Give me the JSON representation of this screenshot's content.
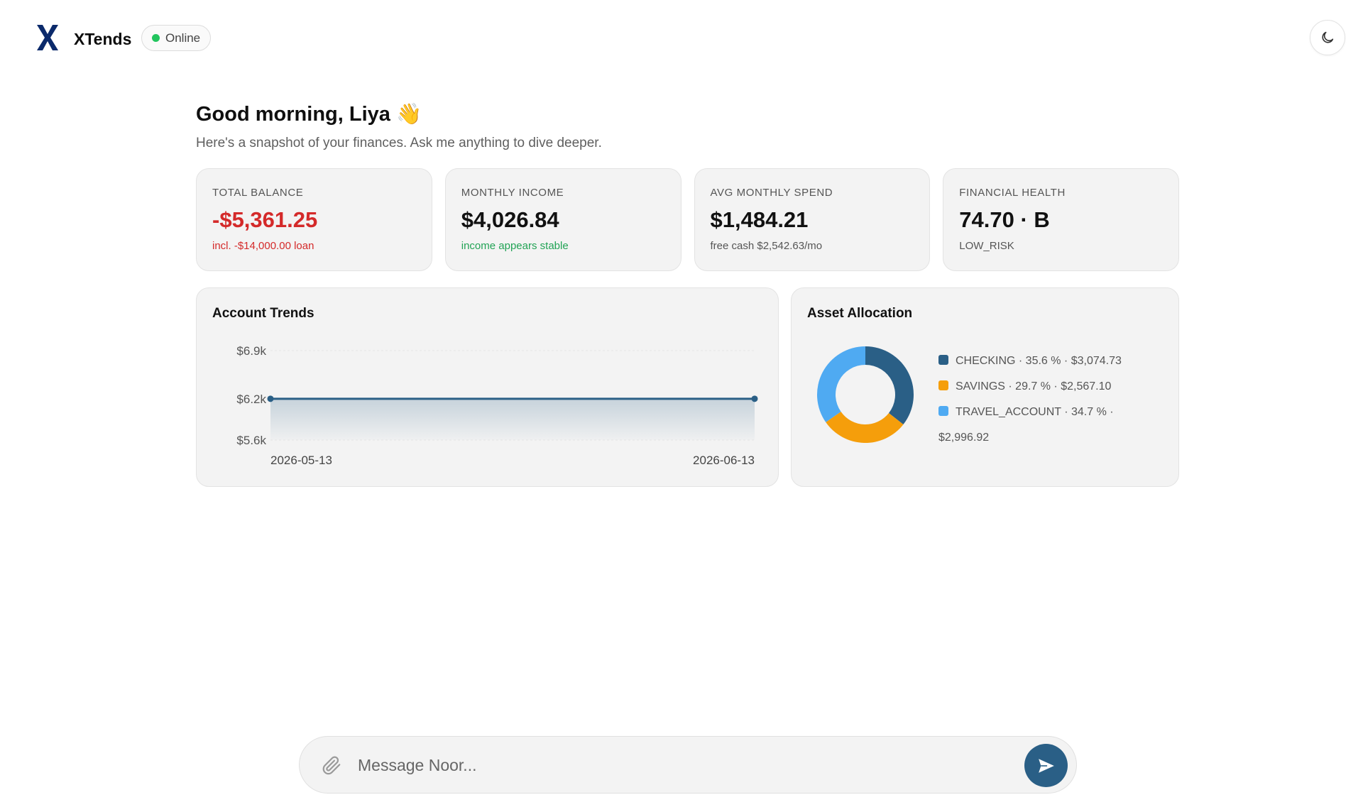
{
  "header": {
    "brand": "XTends",
    "status": "Online",
    "colors": {
      "logo": "#0b2a6b",
      "status_dot": "#22c55e"
    }
  },
  "greeting": {
    "title": "Good morning, Liya 👋",
    "subtitle": "Here's a snapshot of your finances. Ask me anything to dive deeper."
  },
  "kpis": [
    {
      "label": "TOTAL BALANCE",
      "value": "-$5,361.25",
      "note": "incl. -$14,000.00 loan"
    },
    {
      "label": "MONTHLY INCOME",
      "value": "$4,026.84",
      "note": "income appears stable"
    },
    {
      "label": "AVG MONTHLY SPEND",
      "value": "$1,484.21",
      "note": "free cash $2,542.63/mo"
    },
    {
      "label": "FINANCIAL HEALTH",
      "value": "74.70 · B",
      "note": "LOW_RISK"
    }
  ],
  "panels": {
    "trends_title": "Account Trends",
    "allocation_title": "Asset Allocation"
  },
  "chart_data": [
    {
      "type": "area",
      "title": "Account Trends",
      "x": [
        "2026-05-13",
        "2026-06-13"
      ],
      "series": [
        {
          "values": [
            6200,
            6200
          ]
        }
      ],
      "yticks": [
        "$6.9k",
        "$6.2k",
        "$5.6k"
      ],
      "ytick_values": [
        6900,
        6200,
        5600
      ],
      "xticks": [
        "2026-05-13",
        "2026-06-13"
      ],
      "ylim": [
        5600,
        6900
      ],
      "grid": true,
      "color": "#2a5f86"
    },
    {
      "type": "pie",
      "title": "Asset Allocation",
      "donut": true,
      "categories": [
        "CHECKING",
        "SAVINGS",
        "TRAVEL_ACCOUNT"
      ],
      "percents": [
        "35.6",
        "29.7",
        "34.7"
      ],
      "amounts": [
        "$3,074.73",
        "$2,567.10",
        "$2,996.92"
      ],
      "values": [
        35.6,
        29.7,
        34.7
      ],
      "colors": [
        "#2a5f86",
        "#f59e0b",
        "#4faaf2"
      ]
    }
  ],
  "composer": {
    "placeholder": "Message Noor...",
    "send_icon": "send-icon",
    "attach_icon": "paperclip-icon"
  },
  "theme_toggle": {
    "icon": "moon-icon"
  }
}
